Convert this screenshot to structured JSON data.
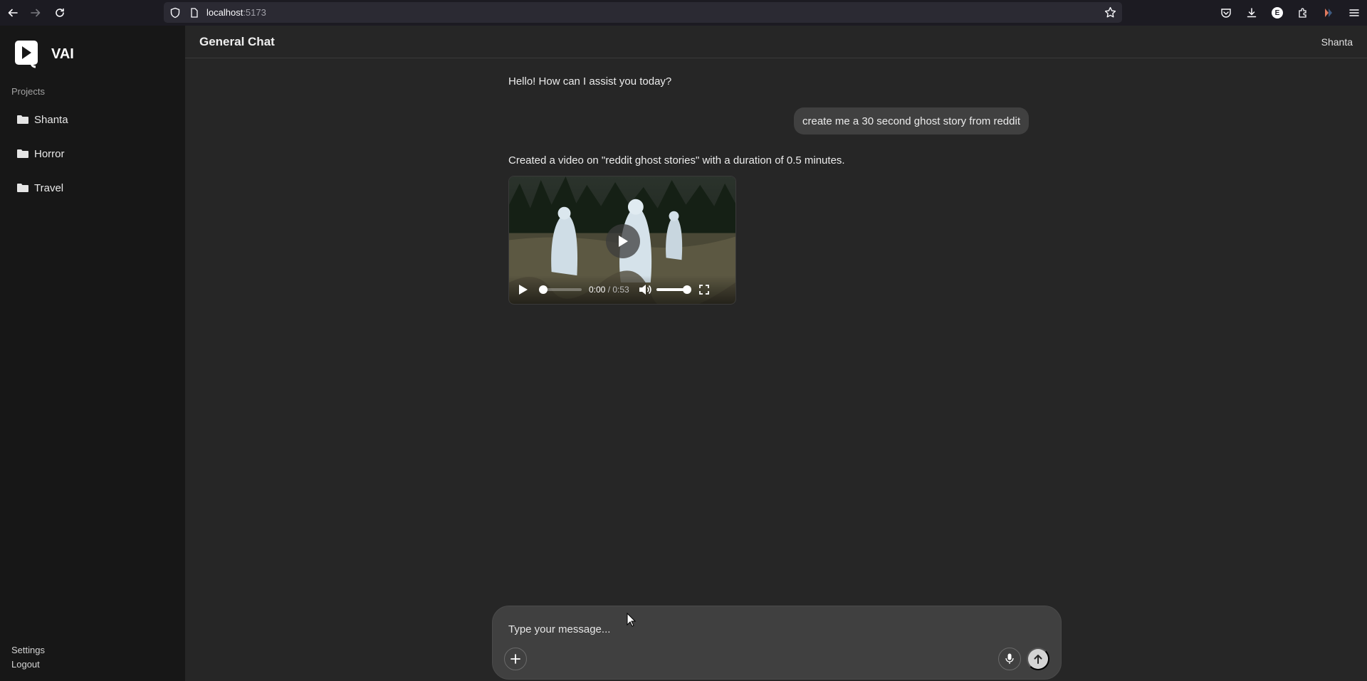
{
  "browser": {
    "url_host": "localhost",
    "url_port": ":5173",
    "extension_letter": "E"
  },
  "sidebar": {
    "brand": "VAI",
    "projects_label": "Projects",
    "projects": [
      {
        "label": "Shanta"
      },
      {
        "label": "Horror"
      },
      {
        "label": "Travel"
      }
    ],
    "footer": {
      "settings": "Settings",
      "logout": "Logout"
    }
  },
  "header": {
    "title": "General Chat",
    "user": "Shanta"
  },
  "messages": [
    {
      "role": "assistant",
      "text": "Hello! How can I assist you today?"
    },
    {
      "role": "user",
      "text": "create me a 30 second ghost story from reddit"
    },
    {
      "role": "assistant",
      "text": "Created a video on \"reddit ghost stories\" with a duration of 0.5 minutes."
    }
  ],
  "video": {
    "current_time": "0:00",
    "duration": " / 0:53",
    "progress": 0,
    "volume": 1.0
  },
  "composer": {
    "placeholder": "Type your message..."
  },
  "colors": {
    "sidebar_bg": "#171717",
    "main_bg": "#262626",
    "bubble_bg": "#404040",
    "send_button": "#d4d4d4"
  }
}
